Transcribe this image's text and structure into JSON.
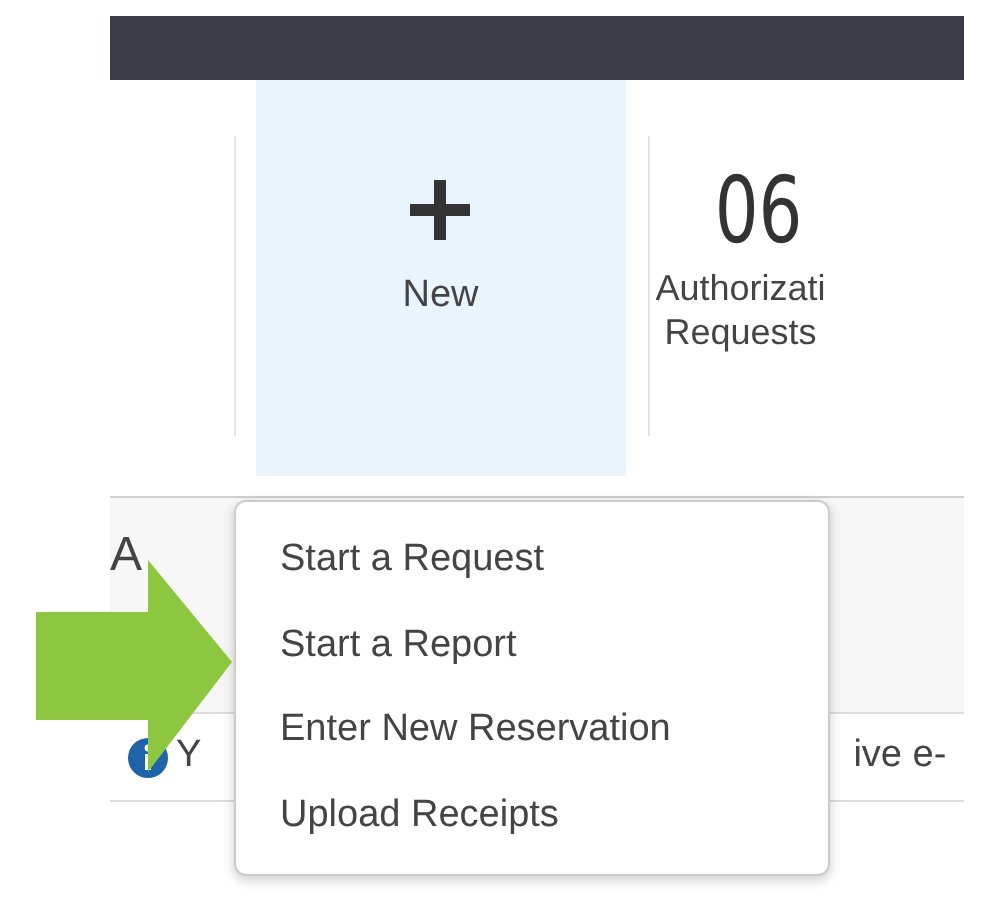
{
  "tiles": [
    {
      "kind": "action",
      "label": "New",
      "selected": true
    },
    {
      "kind": "count",
      "count": "06",
      "label_lines": [
        "Authorizati",
        "Requests"
      ],
      "selected": false
    }
  ],
  "section_heading": "A",
  "info": {
    "text_before": "Y",
    "text_after": "ive e-"
  },
  "dropdown": {
    "items": [
      "Start a Request",
      "Start a Report",
      "Enter New Reservation",
      "Upload Receipts"
    ]
  }
}
